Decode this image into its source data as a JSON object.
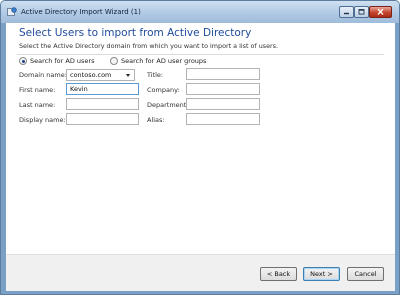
{
  "window": {
    "title": "Active Directory Import Wizard (1)",
    "icons": [
      "wizard-app-icon",
      "minimize-icon",
      "maximize-icon",
      "close-icon"
    ]
  },
  "page": {
    "heading": "Select Users to import from Active Directory",
    "subheading": "Select the Active Directory domain from which you want to import a list of users."
  },
  "search_mode": {
    "ad_users_label": "Search for AD users",
    "ad_groups_label": "Search for AD user groups",
    "selected": "ad_users"
  },
  "form": {
    "domain_label": "Domain name:",
    "domain_value": "contoso.com",
    "first_name_label": "First name:",
    "first_name_value": "Kevin",
    "last_name_label": "Last name:",
    "last_name_value": "",
    "display_name_label": "Display name:",
    "display_name_value": "",
    "title_label": "Title:",
    "title_value": "",
    "company_label": "Company:",
    "company_value": "",
    "department_label": "Department:",
    "department_value": "",
    "alias_label": "Alias:",
    "alias_value": ""
  },
  "buttons": {
    "back": "< Back",
    "next": "Next >",
    "cancel": "Cancel"
  },
  "colors": {
    "heading": "#1f4b9b",
    "frame": "#7ba0c6",
    "close_button": "#c5452d"
  }
}
